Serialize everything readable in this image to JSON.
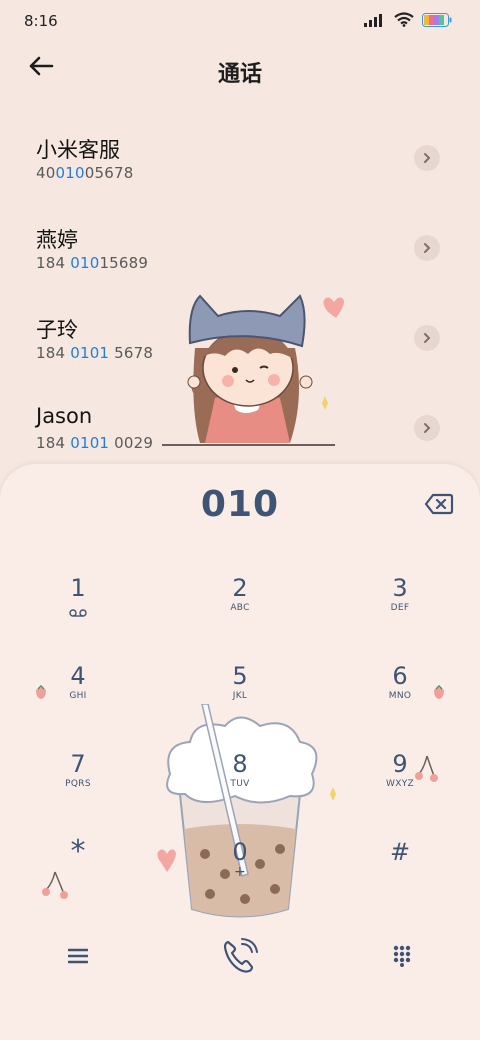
{
  "status": {
    "time": "8:16"
  },
  "header": {
    "title": "通话"
  },
  "contacts": [
    {
      "name": "小米客服",
      "num_pre": "40",
      "num_hl": "010",
      "num_post": "05678"
    },
    {
      "name": "燕婷",
      "num_pre": "184 ",
      "num_hl": "010",
      "num_post": "15689"
    },
    {
      "name": "子玲",
      "num_pre": "184 ",
      "num_hl": "0101",
      "num_post": " 5678"
    },
    {
      "name": "Jason",
      "num_pre": "184 ",
      "num_hl": "0101",
      "num_post": " 0029"
    }
  ],
  "dialer": {
    "entry": "010",
    "keys": [
      {
        "digit": "1",
        "letters": ""
      },
      {
        "digit": "2",
        "letters": "ABC"
      },
      {
        "digit": "3",
        "letters": "DEF"
      },
      {
        "digit": "4",
        "letters": "GHI"
      },
      {
        "digit": "5",
        "letters": "JKL"
      },
      {
        "digit": "6",
        "letters": "MNO"
      },
      {
        "digit": "7",
        "letters": "PQRS"
      },
      {
        "digit": "8",
        "letters": "TUV"
      },
      {
        "digit": "9",
        "letters": "WXYZ"
      },
      {
        "digit": "*",
        "letters": ""
      },
      {
        "digit": "0",
        "letters": "+"
      },
      {
        "digit": "#",
        "letters": ""
      }
    ]
  },
  "icons": {
    "back": "arrow-left-icon",
    "signal": "signal-icon",
    "wifi": "wifi-icon",
    "battery": "battery-icon",
    "voicemail": "voicemail-icon",
    "backspace": "backspace-icon",
    "menu": "menu-icon",
    "call": "phone-icon",
    "keypad": "keypad-icon"
  },
  "colors": {
    "accent": "#1e7fdc",
    "keys": "#3f5475",
    "background": "#f6e8e1"
  }
}
